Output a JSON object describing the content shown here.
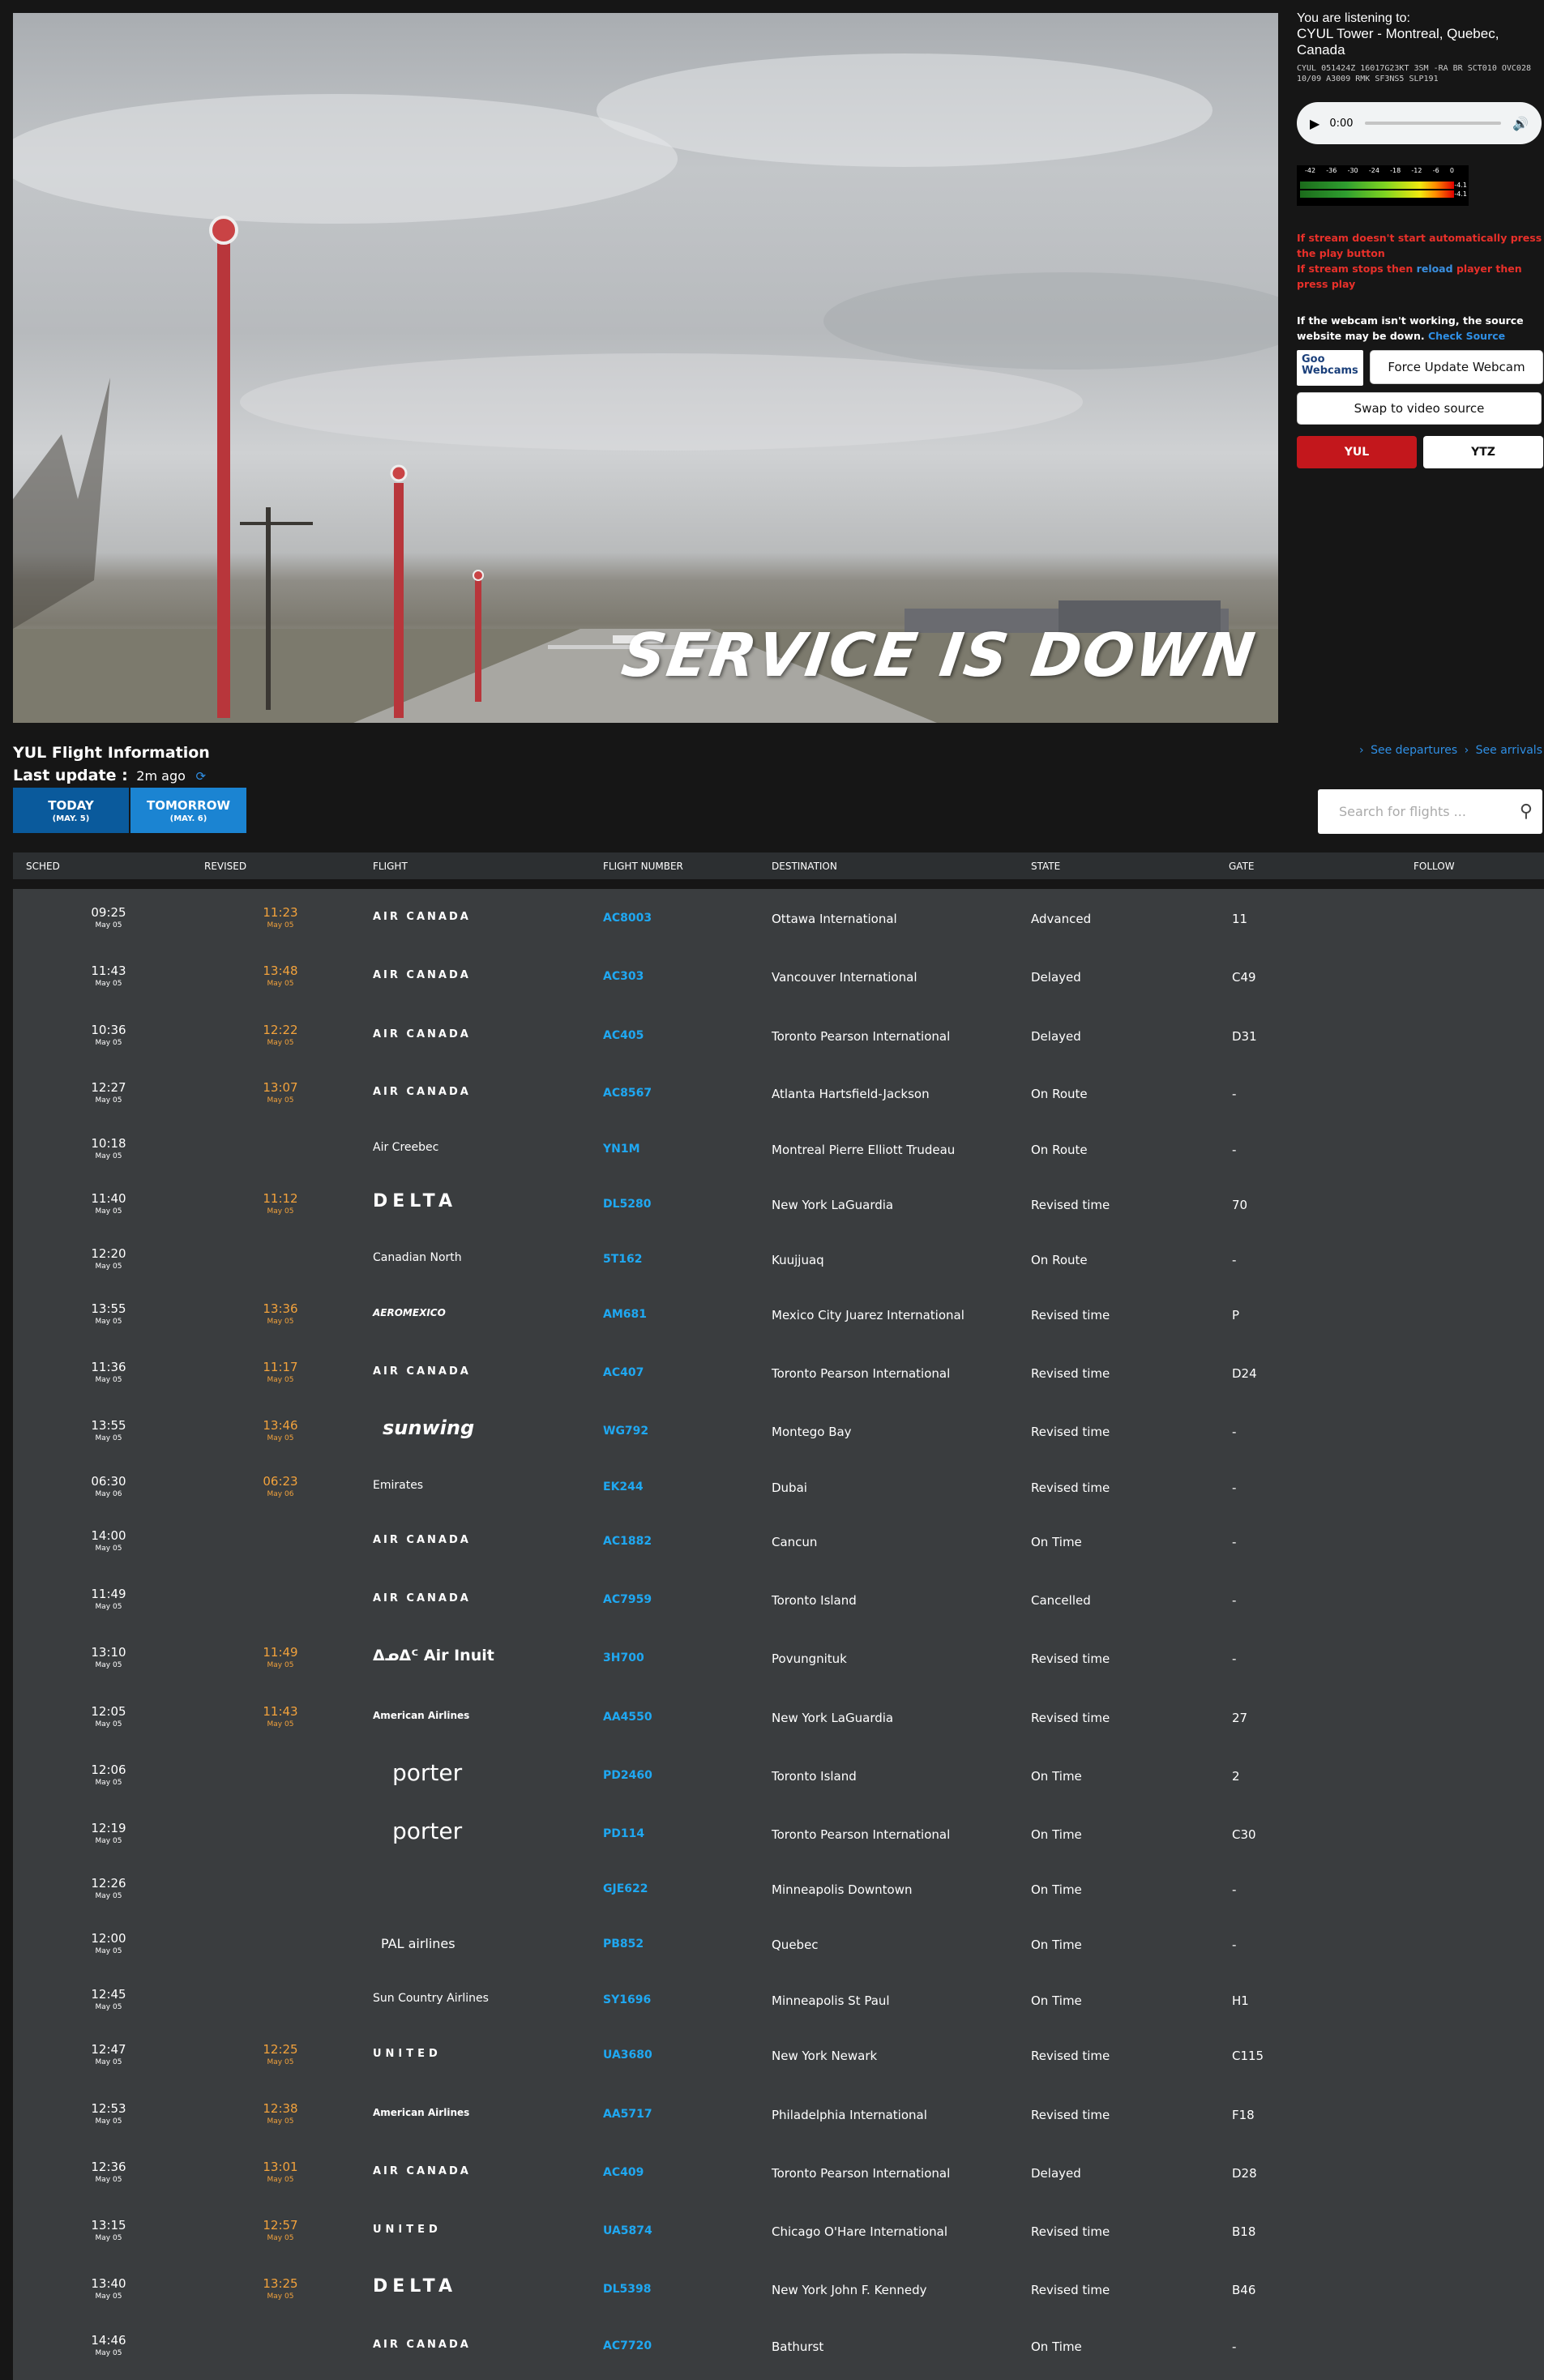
{
  "webcam": {
    "overlay_text": "SERVICE IS DOWN"
  },
  "audio": {
    "listen_label": "You are listening to:",
    "station": "CYUL Tower - Montreal, Quebec, Canada",
    "metar": "CYUL 051424Z 16017G23KT 3SM -RA BR SCT010 OVC028 10/09 A3009 RMK SF3NS5 SLP191",
    "time": "0:00",
    "meter_ticks": [
      "-42",
      "-36",
      "-30",
      "-24",
      "-18",
      "-12",
      "-6",
      "0"
    ],
    "meter_db": [
      "-4.1",
      "-4.1"
    ]
  },
  "notes": {
    "stream_1": "If stream doesn't start automatically press the play button",
    "stream_2_a": "If stream stops then",
    "stream_2_link": "reload",
    "stream_2_b": "player then press play",
    "webcam_note": "If the webcam isn't working, the source website may be down.",
    "check_source": "Check Source"
  },
  "buttons": {
    "goo_line1": "Goo",
    "goo_line2": "Webcams",
    "force_update": "Force Update Webcam",
    "swap": "Swap to video source",
    "yul": "YUL",
    "ytz": "YTZ"
  },
  "flight_info": {
    "title": "YUL Flight Information",
    "last_update_label": "Last update :",
    "last_update_value": "2m ago",
    "see_departures": "See departures",
    "see_arrivals": "See arrivals",
    "tabs": [
      {
        "label": "TODAY",
        "date": "(MAY. 5)"
      },
      {
        "label": "TOMORROW",
        "date": "(MAY. 6)"
      }
    ],
    "search_placeholder": "Search for flights ..."
  },
  "columns": [
    "SCHED",
    "REVISED",
    "FLIGHT",
    "FLIGHT NUMBER",
    "DESTINATION",
    "STATE",
    "GATE",
    "FOLLOW"
  ],
  "flights": [
    {
      "sched": "09:25",
      "sched_date": "May 05",
      "revised": "11:23",
      "revised_date": "May 05",
      "airline": "AIR CANADA",
      "number": "AC8003",
      "destination": "Ottawa International",
      "state": "Advanced",
      "gate": "11"
    },
    {
      "sched": "11:43",
      "sched_date": "May 05",
      "revised": "13:48",
      "revised_date": "May 05",
      "airline": "AIR CANADA",
      "number": "AC303",
      "destination": "Vancouver International",
      "state": "Delayed",
      "gate": "C49"
    },
    {
      "sched": "10:36",
      "sched_date": "May 05",
      "revised": "12:22",
      "revised_date": "May 05",
      "airline": "AIR CANADA",
      "number": "AC405",
      "destination": "Toronto Pearson International",
      "state": "Delayed",
      "gate": "D31"
    },
    {
      "sched": "12:27",
      "sched_date": "May 05",
      "revised": "13:07",
      "revised_date": "May 05",
      "airline": "AIR CANADA",
      "number": "AC8567",
      "destination": "Atlanta Hartsfield-Jackson",
      "state": "On Route",
      "gate": "-"
    },
    {
      "sched": "10:18",
      "sched_date": "May 05",
      "revised": "",
      "revised_date": "",
      "airline": "Air Creebec",
      "number": "YN1M",
      "destination": "Montreal Pierre Elliott Trudeau",
      "state": "On Route",
      "gate": "-"
    },
    {
      "sched": "11:40",
      "sched_date": "May 05",
      "revised": "11:12",
      "revised_date": "May 05",
      "airline": "DELTA",
      "number": "DL5280",
      "destination": "New York LaGuardia",
      "state": "Revised time",
      "gate": "70"
    },
    {
      "sched": "12:20",
      "sched_date": "May 05",
      "revised": "",
      "revised_date": "",
      "airline": "Canadian North",
      "number": "5T162",
      "destination": "Kuujjuaq",
      "state": "On Route",
      "gate": "-"
    },
    {
      "sched": "13:55",
      "sched_date": "May 05",
      "revised": "13:36",
      "revised_date": "May 05",
      "airline": "AEROMEXICO",
      "number": "AM681",
      "destination": "Mexico City Juarez International",
      "state": "Revised time",
      "gate": "P"
    },
    {
      "sched": "11:36",
      "sched_date": "May 05",
      "revised": "11:17",
      "revised_date": "May 05",
      "airline": "AIR CANADA",
      "number": "AC407",
      "destination": "Toronto Pearson International",
      "state": "Revised time",
      "gate": "D24"
    },
    {
      "sched": "13:55",
      "sched_date": "May 05",
      "revised": "13:46",
      "revised_date": "May 05",
      "airline": "sunwing",
      "number": "WG792",
      "destination": "Montego Bay",
      "state": "Revised time",
      "gate": "-"
    },
    {
      "sched": "06:30",
      "sched_date": "May 06",
      "revised": "06:23",
      "revised_date": "May 06",
      "airline": "Emirates",
      "number": "EK244",
      "destination": "Dubai",
      "state": "Revised time",
      "gate": "-"
    },
    {
      "sched": "14:00",
      "sched_date": "May 05",
      "revised": "",
      "revised_date": "",
      "airline": "AIR CANADA",
      "number": "AC1882",
      "destination": "Cancun",
      "state": "On Time",
      "gate": "-"
    },
    {
      "sched": "11:49",
      "sched_date": "May 05",
      "revised": "",
      "revised_date": "",
      "airline": "AIR CANADA",
      "number": "AC7959",
      "destination": "Toronto Island",
      "state": "Cancelled",
      "gate": "-"
    },
    {
      "sched": "13:10",
      "sched_date": "May 05",
      "revised": "11:49",
      "revised_date": "May 05",
      "airline": "ᐃᓄᐃᑦ Air Inuit",
      "number": "3H700",
      "destination": "Povungnituk",
      "state": "Revised time",
      "gate": "-"
    },
    {
      "sched": "12:05",
      "sched_date": "May 05",
      "revised": "11:43",
      "revised_date": "May 05",
      "airline": "American Airlines",
      "number": "AA4550",
      "destination": "New York LaGuardia",
      "state": "Revised time",
      "gate": "27"
    },
    {
      "sched": "12:06",
      "sched_date": "May 05",
      "revised": "",
      "revised_date": "",
      "airline": "porter",
      "number": "PD2460",
      "destination": "Toronto Island",
      "state": "On Time",
      "gate": "2"
    },
    {
      "sched": "12:19",
      "sched_date": "May 05",
      "revised": "",
      "revised_date": "",
      "airline": "porter",
      "number": "PD114",
      "destination": "Toronto Pearson International",
      "state": "On Time",
      "gate": "C30"
    },
    {
      "sched": "12:26",
      "sched_date": "May 05",
      "revised": "",
      "revised_date": "",
      "airline": "",
      "number": "GJE622",
      "destination": "Minneapolis Downtown",
      "state": "On Time",
      "gate": "-"
    },
    {
      "sched": "12:00",
      "sched_date": "May 05",
      "revised": "",
      "revised_date": "",
      "airline": "PAL airlines",
      "number": "PB852",
      "destination": "Quebec",
      "state": "On Time",
      "gate": "-"
    },
    {
      "sched": "12:45",
      "sched_date": "May 05",
      "revised": "",
      "revised_date": "",
      "airline": "Sun Country Airlines",
      "number": "SY1696",
      "destination": "Minneapolis St Paul",
      "state": "On Time",
      "gate": "H1"
    },
    {
      "sched": "12:47",
      "sched_date": "May 05",
      "revised": "12:25",
      "revised_date": "May 05",
      "airline": "UNITED",
      "number": "UA3680",
      "destination": "New York Newark",
      "state": "Revised time",
      "gate": "C115"
    },
    {
      "sched": "12:53",
      "sched_date": "May 05",
      "revised": "12:38",
      "revised_date": "May 05",
      "airline": "American Airlines",
      "number": "AA5717",
      "destination": "Philadelphia International",
      "state": "Revised time",
      "gate": "F18"
    },
    {
      "sched": "12:36",
      "sched_date": "May 05",
      "revised": "13:01",
      "revised_date": "May 05",
      "airline": "AIR CANADA",
      "number": "AC409",
      "destination": "Toronto Pearson International",
      "state": "Delayed",
      "gate": "D28"
    },
    {
      "sched": "13:15",
      "sched_date": "May 05",
      "revised": "12:57",
      "revised_date": "May 05",
      "airline": "UNITED",
      "number": "UA5874",
      "destination": "Chicago O'Hare International",
      "state": "Revised time",
      "gate": "B18"
    },
    {
      "sched": "13:40",
      "sched_date": "May 05",
      "revised": "13:25",
      "revised_date": "May 05",
      "airline": "DELTA",
      "number": "DL5398",
      "destination": "New York John F. Kennedy",
      "state": "Revised time",
      "gate": "B46"
    },
    {
      "sched": "14:46",
      "sched_date": "May 05",
      "revised": "",
      "revised_date": "",
      "airline": "AIR CANADA",
      "number": "AC7720",
      "destination": "Bathurst",
      "state": "On Time",
      "gate": "-"
    }
  ]
}
